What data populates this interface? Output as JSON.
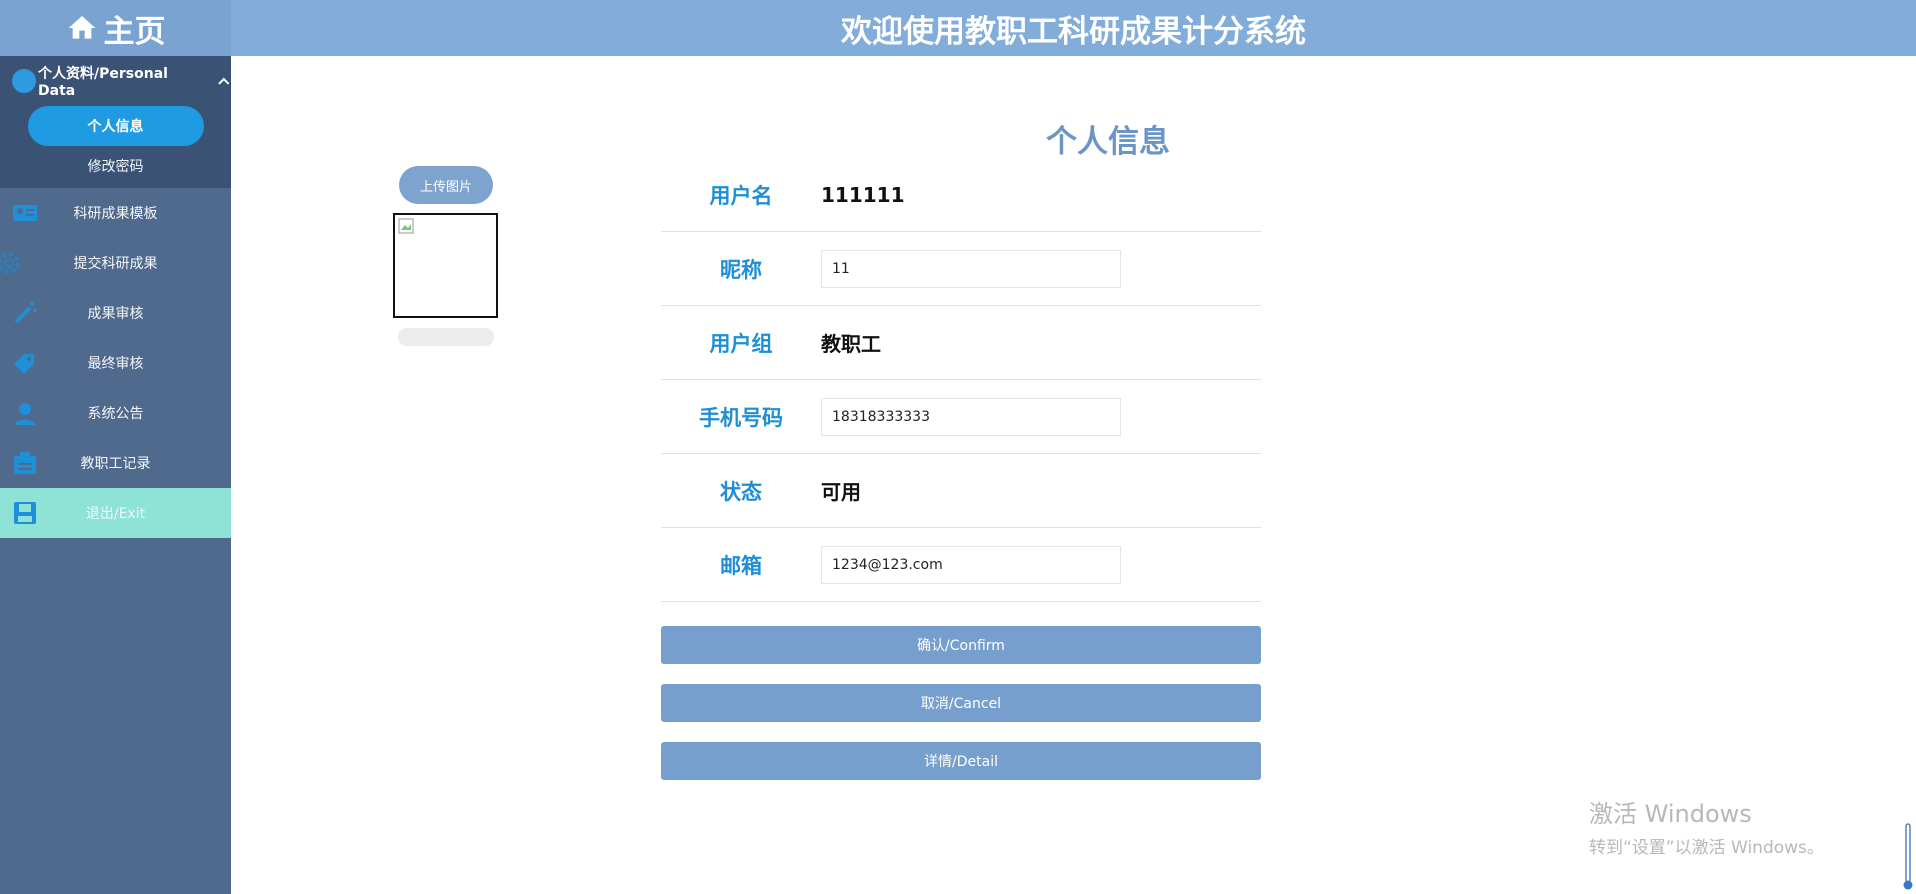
{
  "sidebar": {
    "home_label": "主页",
    "section_label": "个人资料/Personal Data",
    "sub_items": [
      {
        "label": "个人信息",
        "active": true
      },
      {
        "label": "修改密码",
        "active": false
      }
    ],
    "items": [
      {
        "label": "科研成果模板",
        "icon": "id-card-icon"
      },
      {
        "label": "提交科研成果",
        "icon": "gear-icon"
      },
      {
        "label": "成果审核",
        "icon": "magic-wand-icon"
      },
      {
        "label": "最终审核",
        "icon": "tags-icon"
      },
      {
        "label": "系统公告",
        "icon": "user-icon"
      },
      {
        "label": "教职工记录",
        "icon": "clipboard-icon"
      }
    ],
    "exit_label": "退出/Exit"
  },
  "header": {
    "title": "欢迎使用教职工科研成果计分系统"
  },
  "main": {
    "title": "个人信息",
    "upload_label": "上传图片",
    "fields": {
      "username": {
        "label": "用户名",
        "value": "111111"
      },
      "nickname": {
        "label": "昵称",
        "value": "11"
      },
      "group": {
        "label": "用户组",
        "value": "教职工"
      },
      "phone": {
        "label": "手机号码",
        "value": "18318333333"
      },
      "status": {
        "label": "状态",
        "value": "可用"
      },
      "email": {
        "label": "邮箱",
        "value": "1234@123.com"
      }
    },
    "buttons": {
      "confirm": "确认/Confirm",
      "cancel": "取消/Cancel",
      "detail": "详情/Detail"
    }
  },
  "watermark": {
    "line1": "激活 Windows",
    "line2": "转到“设置”以激活 Windows。"
  },
  "colors": {
    "sidebar": "#4f6a8c",
    "header": "#82acd9",
    "accent": "#1f9be4",
    "exit": "#8fe3d6",
    "button": "#779fcd",
    "label": "#1e8ed6"
  }
}
